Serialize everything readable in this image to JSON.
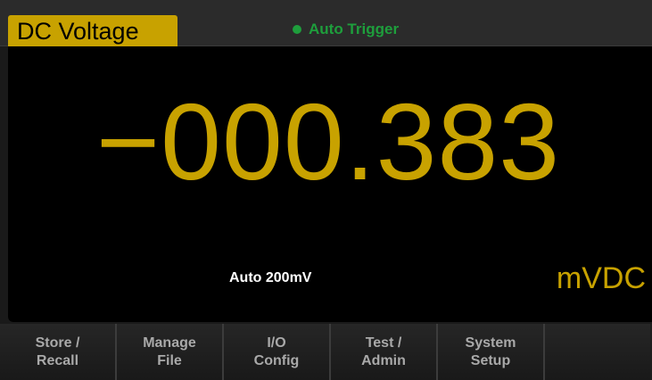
{
  "header": {
    "mode": "DC Voltage",
    "trigger": "Auto Trigger"
  },
  "display": {
    "reading": "−000.383",
    "range": "Auto  200mV",
    "unit": "mVDC"
  },
  "softkeys": [
    {
      "line1": "Store /",
      "line2": "Recall"
    },
    {
      "line1": "Manage",
      "line2": "File"
    },
    {
      "line1": "I/O",
      "line2": "Config"
    },
    {
      "line1": "Test /",
      "line2": "Admin"
    },
    {
      "line1": "System",
      "line2": "Setup"
    }
  ],
  "colors": {
    "accent": "#c8a200",
    "trigger": "#1e9e3c",
    "background": "#000000"
  }
}
